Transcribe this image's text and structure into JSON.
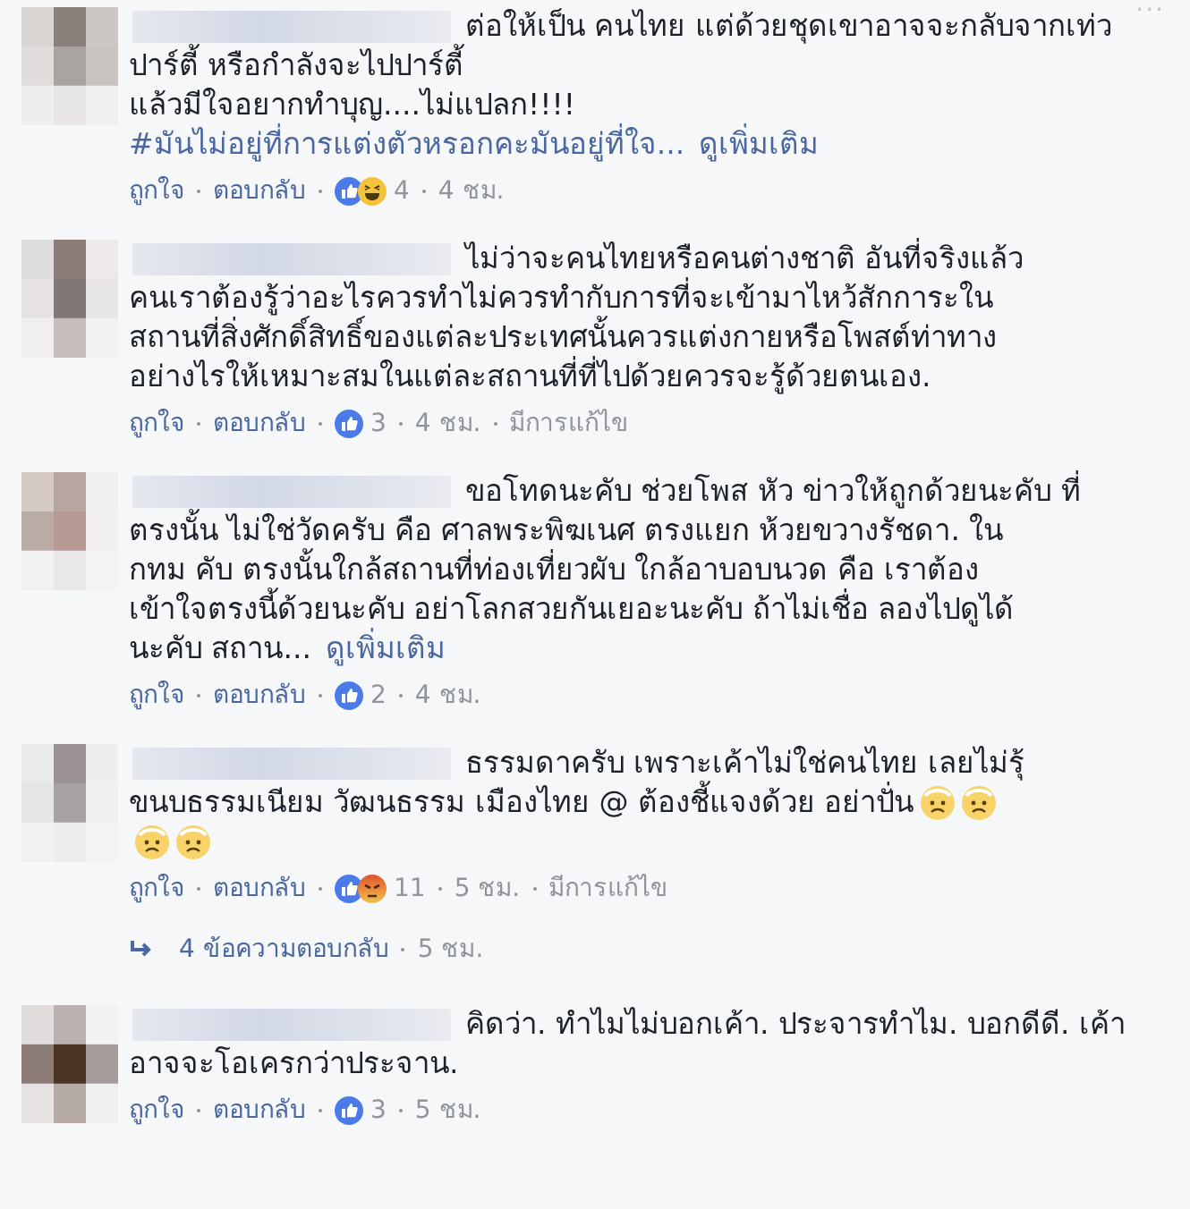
{
  "more_button": {
    "label": "···"
  },
  "comments": [
    {
      "body": [
        {
          "kind": "text",
          "text": "ต่อให้เป็น คนไทย แต่ด้วยชุดเขาอาจจะกลับจากเท่ว\nปาร์ตี้ หรือกำลังจะไปปาร์ตี้\nแล้วมีใจอยากทำบุญ....ไม่แปลก!!!!\n"
        },
        {
          "kind": "hashtag",
          "text": "#มันไม่อยู่ที่การแต่งตัวหรอกคะมันอยู่ที่ใจ..."
        },
        {
          "kind": "see_more",
          "text": "ดูเพิ่มเติม"
        }
      ],
      "like_label": "ถูกใจ",
      "reply_label": "ตอบกลับ",
      "reactions": [
        {
          "kind": "like"
        },
        {
          "kind": "haha"
        }
      ],
      "reaction_count": "4",
      "time": "4 ชม.",
      "edited": false
    },
    {
      "body": [
        {
          "kind": "text",
          "text": "ไม่ว่าจะคนไทยหรือคนต่างชาติ อันที่จริงแล้ว\nคนเราต้องรู้ว่าอะไรควรทำไม่ควรทำกับการที่จะเข้ามาไหว้สักการะใน\nสถานที่สิ่งศักดิ์สิทธิ์ของแต่ละประเทศนั้นควรแต่งกายหรือโพสต์ท่าทาง\nอย่างไรให้เหมาะสมในแต่ละสถานที่ที่ไปด้วยควรจะรู้ด้วยตนเอง."
        }
      ],
      "like_label": "ถูกใจ",
      "reply_label": "ตอบกลับ",
      "reactions": [
        {
          "kind": "like"
        }
      ],
      "reaction_count": "3",
      "time": "4 ชม.",
      "edited": true,
      "edited_label": "มีการแก้ไข"
    },
    {
      "body": [
        {
          "kind": "text",
          "text": "ขอโทดนะคับ ช่วยโพส หัว ข่าวให้ถูกด้วยนะคับ ที่\nตรงนั้น ไม่ใช่วัดครับ คือ ศาลพระพิฆเนศ ตรงแยก ห้วยขวางรัชดา. ใน\nกทม คับ ตรงนั้นใกล้สถานที่ท่องเที่ยวผับ ใกล้อาบอบนวด คือ เราต้อง\nเข้าใจตรงนี้ด้วยนะคับ อย่าโลกสวยกันเยอะนะคับ ถ้าไม่เชื่อ ลองไปดูได้\nนะคับ สถาน..."
        },
        {
          "kind": "see_more",
          "text": "ดูเพิ่มเติม"
        }
      ],
      "like_label": "ถูกใจ",
      "reply_label": "ตอบกลับ",
      "reactions": [
        {
          "kind": "like"
        }
      ],
      "reaction_count": "2",
      "time": "4 ชม.",
      "edited": false
    },
    {
      "body": [
        {
          "kind": "text",
          "text": "ธรรมดาครับ เพราะเค้าไม่ใช่คนไทย เลยไม่รุ้\nขนบธรรมเนียม วัฒนธรรม เมืองไทย @ ต้องชี้แจงด้วย อย่าปั่น"
        },
        {
          "kind": "emoji"
        },
        {
          "kind": "emoji"
        },
        {
          "kind": "break"
        },
        {
          "kind": "emoji"
        },
        {
          "kind": "emoji"
        }
      ],
      "like_label": "ถูกใจ",
      "reply_label": "ตอบกลับ",
      "reactions": [
        {
          "kind": "like"
        },
        {
          "kind": "angry"
        }
      ],
      "reaction_count": "11",
      "time": "5 ชม.",
      "edited": true,
      "edited_label": "มีการแก้ไข",
      "replies": {
        "label": "4 ข้อความตอบกลับ",
        "time": "5 ชม."
      }
    },
    {
      "body": [
        {
          "kind": "text",
          "text": "คิดว่า. ทำไมไม่บอกเค้า. ประจารทำไม. บอกดีดี. เค้า\nอาจจะโอเครกว่าประจาน."
        }
      ],
      "like_label": "ถูกใจ",
      "reply_label": "ตอบกลับ",
      "reactions": [
        {
          "kind": "like"
        }
      ],
      "reaction_count": "3",
      "time": "5 ชม.",
      "edited": false
    }
  ]
}
